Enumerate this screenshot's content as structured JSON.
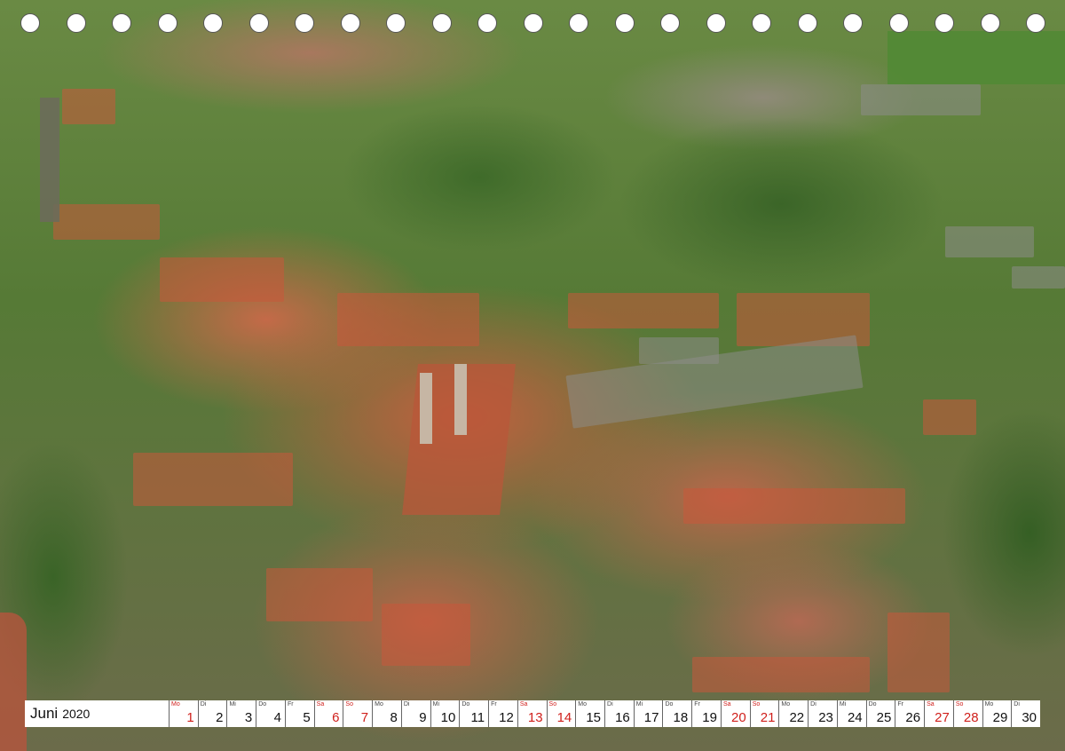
{
  "calendar": {
    "month": "Juni",
    "year": "2020",
    "days": [
      {
        "dow": "Mo",
        "num": "1",
        "red": true
      },
      {
        "dow": "Di",
        "num": "2",
        "red": false
      },
      {
        "dow": "Mi",
        "num": "3",
        "red": false
      },
      {
        "dow": "Do",
        "num": "4",
        "red": false
      },
      {
        "dow": "Fr",
        "num": "5",
        "red": false
      },
      {
        "dow": "Sa",
        "num": "6",
        "red": true
      },
      {
        "dow": "So",
        "num": "7",
        "red": true
      },
      {
        "dow": "Mo",
        "num": "8",
        "red": false
      },
      {
        "dow": "Di",
        "num": "9",
        "red": false
      },
      {
        "dow": "Mi",
        "num": "10",
        "red": false
      },
      {
        "dow": "Do",
        "num": "11",
        "red": false
      },
      {
        "dow": "Fr",
        "num": "12",
        "red": false
      },
      {
        "dow": "Sa",
        "num": "13",
        "red": true
      },
      {
        "dow": "So",
        "num": "14",
        "red": true
      },
      {
        "dow": "Mo",
        "num": "15",
        "red": false
      },
      {
        "dow": "Di",
        "num": "16",
        "red": false
      },
      {
        "dow": "Mi",
        "num": "17",
        "red": false
      },
      {
        "dow": "Do",
        "num": "18",
        "red": false
      },
      {
        "dow": "Fr",
        "num": "19",
        "red": false
      },
      {
        "dow": "Sa",
        "num": "20",
        "red": true
      },
      {
        "dow": "So",
        "num": "21",
        "red": true
      },
      {
        "dow": "Mo",
        "num": "22",
        "red": false
      },
      {
        "dow": "Di",
        "num": "23",
        "red": false
      },
      {
        "dow": "Mi",
        "num": "24",
        "red": false
      },
      {
        "dow": "Do",
        "num": "25",
        "red": false
      },
      {
        "dow": "Fr",
        "num": "26",
        "red": false
      },
      {
        "dow": "Sa",
        "num": "27",
        "red": true
      },
      {
        "dow": "So",
        "num": "28",
        "red": true
      },
      {
        "dow": "Mo",
        "num": "29",
        "red": false
      },
      {
        "dow": "Di",
        "num": "30",
        "red": false
      }
    ]
  },
  "colors": {
    "weekend_red": "#d0201c",
    "text": "#111111",
    "strip": "#ffffff"
  }
}
